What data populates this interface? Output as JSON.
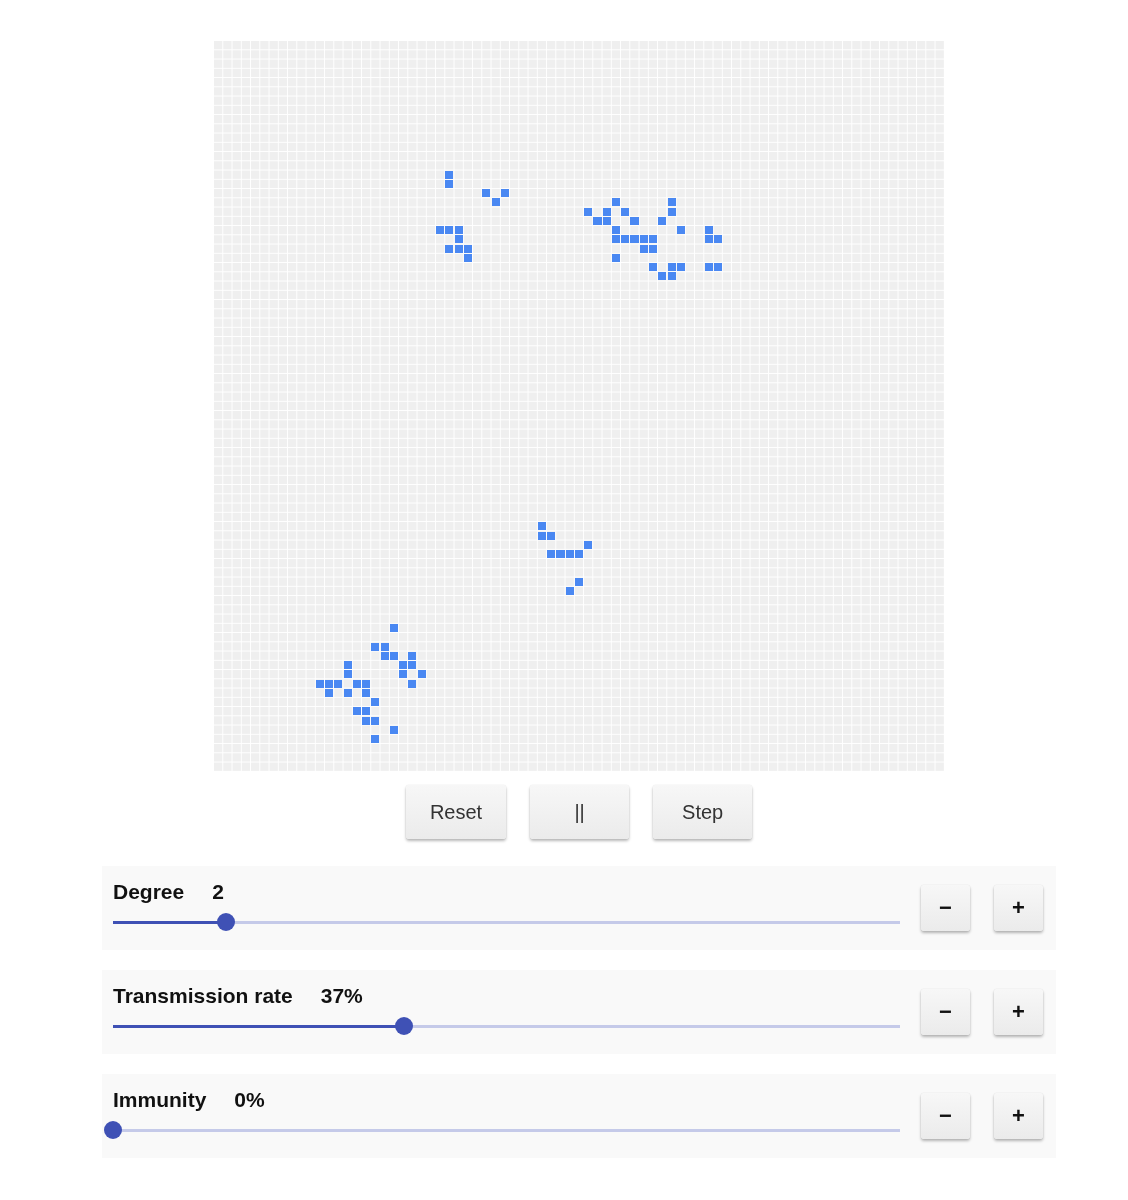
{
  "controls": [
    {
      "label": "Reset"
    },
    {
      "label": "||"
    },
    {
      "label": "Step"
    }
  ],
  "parameters": [
    {
      "label": "Degree",
      "value": "2",
      "level": 0.143,
      "decrement": "−",
      "increment": "+"
    },
    {
      "label": "Transmission rate",
      "value": "37%",
      "level": 0.37,
      "decrement": "−",
      "increment": "+"
    },
    {
      "label": "Immunity",
      "value": "0%",
      "level": 0,
      "decrement": "−",
      "increment": "+"
    }
  ]
}
